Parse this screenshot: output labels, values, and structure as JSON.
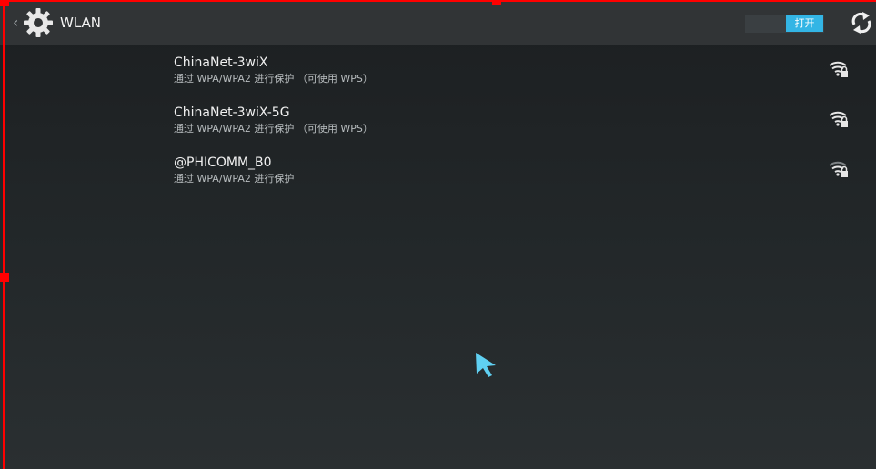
{
  "header": {
    "title": "WLAN",
    "back_icon": "chevron-left-icon",
    "settings_icon": "gear-icon",
    "refresh_icon": "refresh-icon"
  },
  "wifi_switch": {
    "label": "打开",
    "state": "on",
    "accent": "#33b5e5"
  },
  "networks": [
    {
      "ssid": "ChinaNet-3wiX",
      "security": "通过 WPA/WPA2 进行保护 （可使用 WPS）",
      "signal": "strong",
      "locked": true
    },
    {
      "ssid": "ChinaNet-3wiX-5G",
      "security": "通过 WPA/WPA2 进行保护 （可使用 WPS）",
      "signal": "strong",
      "locked": true
    },
    {
      "ssid": "@PHICOMM_B0",
      "security": "通过 WPA/WPA2 进行保护",
      "signal": "medium",
      "locked": true
    }
  ],
  "colors": {
    "cursor": "#5fd0f2",
    "selection": "#ff0000"
  }
}
